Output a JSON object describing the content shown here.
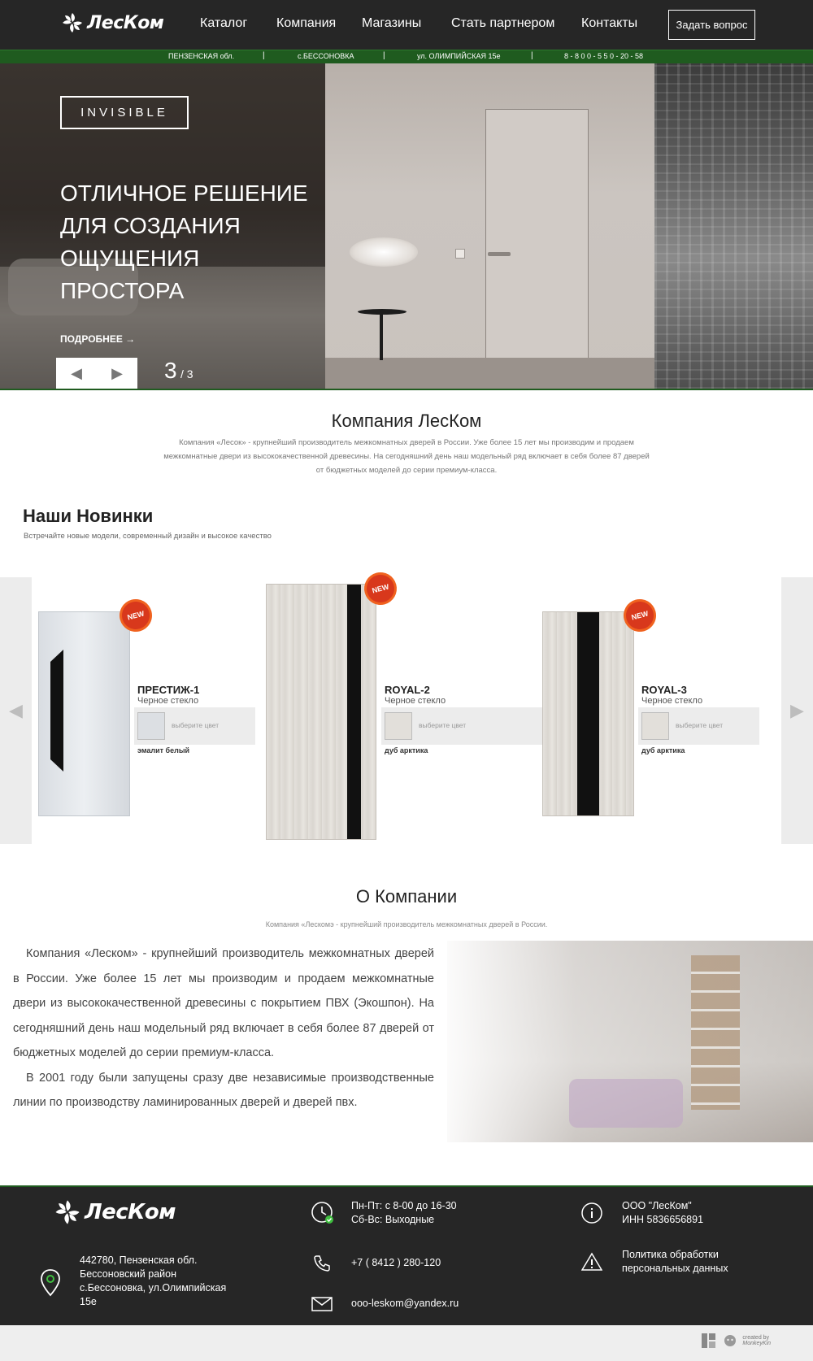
{
  "header": {
    "logo_text": "ЛесКом",
    "nav": [
      "Каталог",
      "Компания",
      "Магазины",
      "Стать партнером",
      "Контакты"
    ],
    "ask_button": "Задать вопрос"
  },
  "infobar": {
    "region": "ПЕНЗЕНСКАЯ обл.",
    "village": "с.БЕССОНОВКА",
    "street": "ул. ОЛИМПИЙСКАЯ 15е",
    "phone": "8 - 8 0 0 - 5 5 0 - 20 - 58",
    "separator": "|"
  },
  "hero": {
    "badge": "INVISIBLE",
    "title": "ОТЛИЧНОЕ РЕШЕНИЕ ДЛЯ СОЗДАНИЯ ОЩУЩЕНИЯ ПРОСТОРА",
    "more_link": "ПОДРОБНЕЕ →",
    "prev_icon": "◀",
    "next_icon": "▶",
    "current_slide": "3",
    "total_slides": "/ 3"
  },
  "company": {
    "title": "Компания ЛесКом",
    "text": "Компания «Лесок» - крупнейший производитель межкомнатных дверей в России. Уже более 15 лет мы производим и продаем межкомнатные двери из высококачественной древесины. На сегодняшний день наш модельный ряд включает в себя более 87 дверей от бюджетных моделей до серии премиум-класса."
  },
  "new_products": {
    "title": "Наши Новинки",
    "subtitle": "Встречайте новые модели, современный дизайн и высокое качество",
    "prev_arrow": "◀",
    "next_arrow": "▶",
    "items": [
      {
        "name": "ПРЕСТИЖ-1",
        "desc": "Черное стекло",
        "choose_color": "выберите цвет",
        "finish": "эмалит белый",
        "badge": "NEW"
      },
      {
        "name": "ROYAL-2",
        "desc": "Черное стекло",
        "choose_color": "выберите цвет",
        "finish": "дуб арктика",
        "badge": "NEW"
      },
      {
        "name": "ROYAL-3",
        "desc": "Черное стекло",
        "choose_color": "выберите цвет",
        "finish": "дуб арктика",
        "badge": "NEW"
      }
    ]
  },
  "about": {
    "title": "О Компании",
    "subtitle": "Компания «Лескомэ - крупнейший производитель межкомнатных дверей в России.",
    "paragraph1": "Компания «Леском» - крупнейший производитель межкомнатных дверей в России. Уже более 15 лет мы производим и продаем межкомнатные двери из высококачественной древесины с покрытием ПВХ (Экошпон). На сегодняшний день наш модельный ряд включает в себя более 87 дверей от бюджетных моделей до серии премиум-класса.",
    "paragraph2": "В 2001 году были запущены сразу две независимые производственные линии по производству ламинированных дверей и дверей пвх."
  },
  "footer": {
    "logo_text": "ЛесКом",
    "address": "442780, Пензенская обл. Бессоновский район с.Бессоновка, ул.Олимпийская 15е",
    "hours_line1": "Пн-Пт: с 8-00 до 16-30",
    "hours_line2": "Сб-Вс: Выходные",
    "phone": "+7 ( 8412 ) 280-120",
    "email": "ooo-leskom@yandex.ru",
    "company_line1": "ООО \"ЛесКом\"",
    "company_line2": "ИНН 5836656891",
    "policy": "Политика обработки персональных данных",
    "credit_line1": "created by",
    "credit_line2": "MonkeyKin"
  },
  "colors": {
    "header_bg": "#262626",
    "accent_green": "#1f5b1f",
    "new_badge": "#d8381c"
  }
}
